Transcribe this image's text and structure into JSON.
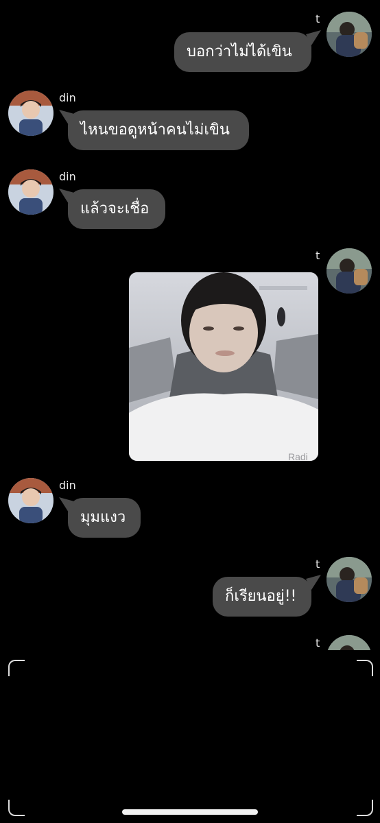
{
  "chat": {
    "messages": [
      {
        "sender": "t",
        "side": "right",
        "text": "บอกว่าไม่ได้เขิน"
      },
      {
        "sender": "din",
        "side": "left",
        "text": "ไหนขอดูหน้าคนไม่เขิน"
      },
      {
        "sender": "din",
        "side": "left",
        "text": "แล้วจะเชื่อ"
      },
      {
        "sender": "t",
        "side": "right",
        "type": "image",
        "text": ""
      },
      {
        "sender": "din",
        "side": "left",
        "text": "มุมแงว"
      },
      {
        "sender": "t",
        "side": "right",
        "text": "ก็เรียนอยู่!!"
      },
      {
        "sender": "t",
        "side": "right",
        "text": ""
      }
    ]
  },
  "colors": {
    "background": "#000000",
    "bubble": "#4a4a4a",
    "text": "#ffffff",
    "frame": "#dddddd"
  },
  "icons": {
    "avatar_left": "avatar-din",
    "avatar_right": "avatar-t"
  }
}
